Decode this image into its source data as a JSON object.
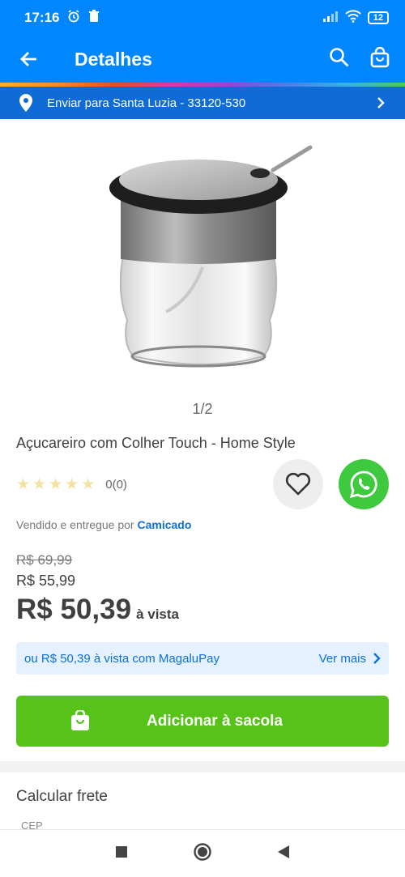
{
  "status_bar": {
    "time": "17:16",
    "battery": "12",
    "icons": [
      "alarm-icon",
      "trash-icon",
      "signal-icon",
      "wifi-icon",
      "battery-icon"
    ]
  },
  "app_bar": {
    "title": "Detalhes",
    "icons": [
      "back-arrow-icon",
      "search-icon",
      "bag-icon"
    ]
  },
  "delivery": {
    "label": "Enviar para Santa Luzia - 33120-530",
    "icon": "location-pin-icon"
  },
  "product": {
    "image_pager": "1/2",
    "title": "Açucareiro com Colher Touch - Home Style",
    "rating_count": "0(0)",
    "stars": 0,
    "seller_prefix": "Vendido e entregue por",
    "seller_name": "Camicado",
    "old_price": "R$ 69,99",
    "mid_price": "R$ 55,99",
    "price": "R$ 50,39",
    "price_suffix": "à vista"
  },
  "magalupay": {
    "text": "ou R$ 50,39 à vista com MagaluPay",
    "more": "Ver mais"
  },
  "add_to_bag": {
    "label": "Adicionar à sacola"
  },
  "shipping": {
    "title": "Calcular frete",
    "cep_label": "CEP"
  },
  "colors": {
    "primary_blue": "#0086ff",
    "delivery_blue": "#0f6bd6",
    "green": "#56c21a",
    "whatsapp_green": "#3ec93e"
  }
}
